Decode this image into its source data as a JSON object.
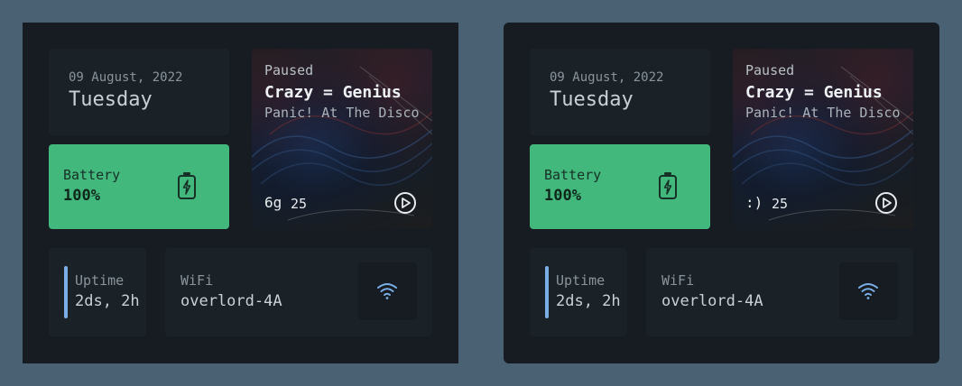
{
  "widgets": [
    {
      "date": "09 August, 2022",
      "day": "Tuesday",
      "battery": {
        "label": "Battery",
        "value": "100%"
      },
      "music": {
        "status": "Paused",
        "song": "Crazy = Genius",
        "artist": "Panic! At The Disco",
        "volume_icon": "6g",
        "volume": "25"
      },
      "uptime": {
        "label": "Uptime",
        "value": "2ds, 2h"
      },
      "wifi": {
        "label": "WiFi",
        "value": "overlord-4A"
      }
    },
    {
      "date": "09 August, 2022",
      "day": "Tuesday",
      "battery": {
        "label": "Battery",
        "value": "100%"
      },
      "music": {
        "status": "Paused",
        "song": "Crazy = Genius",
        "artist": "Panic! At The Disco",
        "volume_icon": ":)",
        "volume": "25"
      },
      "uptime": {
        "label": "Uptime",
        "value": "2ds, 2h"
      },
      "wifi": {
        "label": "WiFi",
        "value": "overlord-4A"
      }
    }
  ],
  "colors": {
    "background": "#4a6073",
    "panel": "#161c21",
    "card": "#1b2227",
    "battery_accent": "#42b87d",
    "uptime_accent": "#7aaee6",
    "wifi_icon": "#7aaee6"
  },
  "icons": {
    "battery": "battery-charging-icon",
    "play": "play-circle-icon",
    "wifi": "wifi-icon"
  }
}
